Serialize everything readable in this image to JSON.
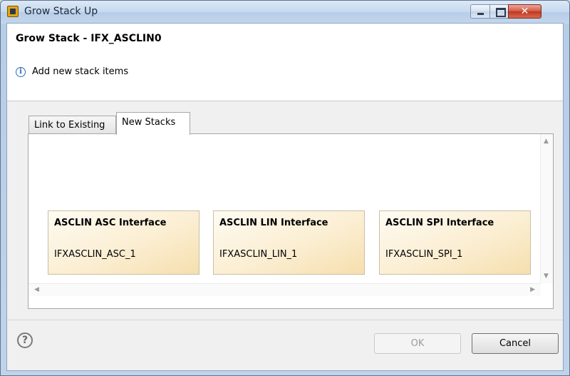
{
  "window": {
    "title": "Grow Stack Up",
    "controls": {
      "minimize": "minimize",
      "maximize": "maximize",
      "close": "close"
    }
  },
  "header": {
    "title": "Grow Stack - IFX_ASCLIN0",
    "message": "Add new stack items",
    "icon": "info-icon"
  },
  "tabs": [
    {
      "label": "Link to Existing",
      "active": false
    },
    {
      "label": "New Stacks",
      "active": true
    }
  ],
  "cards": [
    {
      "title": "ASCLIN ASC Interface",
      "id": "IFXASCLIN_ASC_1"
    },
    {
      "title": "ASCLIN LIN Interface",
      "id": "IFXASCLIN_LIN_1"
    },
    {
      "title": "ASCLIN SPI Interface",
      "id": "IFXASCLIN_SPI_1"
    }
  ],
  "footer": {
    "help_icon": "?",
    "ok_label": "OK",
    "ok_enabled": false,
    "cancel_label": "Cancel"
  },
  "colors": {
    "card_gradient_end": "#f6dfae",
    "close_button": "#c0361d",
    "info_blue": "#2c6bb8"
  }
}
